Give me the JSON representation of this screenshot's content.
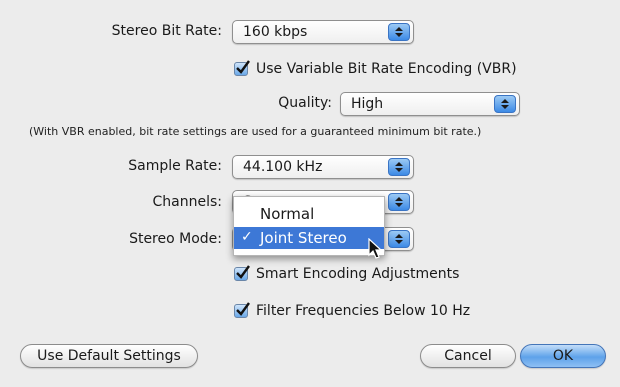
{
  "stereo_bit_rate": {
    "label": "Stereo Bit Rate:",
    "value": "160 kbps"
  },
  "vbr": {
    "label": "Use Variable Bit Rate Encoding (VBR)",
    "checked": true
  },
  "quality": {
    "label": "Quality:",
    "value": "High"
  },
  "vbr_note": "(With VBR enabled, bit rate settings are used for a guaranteed minimum bit rate.)",
  "sample_rate": {
    "label": "Sample Rate:",
    "value": "44.100 kHz"
  },
  "channels": {
    "label": "Channels:",
    "value": "St"
  },
  "stereo_mode": {
    "label": "Stereo Mode:",
    "menu": {
      "options": [
        "Normal",
        "Joint Stereo"
      ],
      "selected": "Joint Stereo",
      "checkmark": "✓"
    }
  },
  "smart_encoding": {
    "label": "Smart Encoding Adjustments",
    "checked": true
  },
  "filter": {
    "label": "Filter Frequencies Below 10 Hz",
    "checked": true
  },
  "buttons": {
    "default_settings": "Use Default Settings",
    "cancel": "Cancel",
    "ok": "OK"
  },
  "colors": {
    "accent": "#3d78d6",
    "background": "#ececec"
  }
}
